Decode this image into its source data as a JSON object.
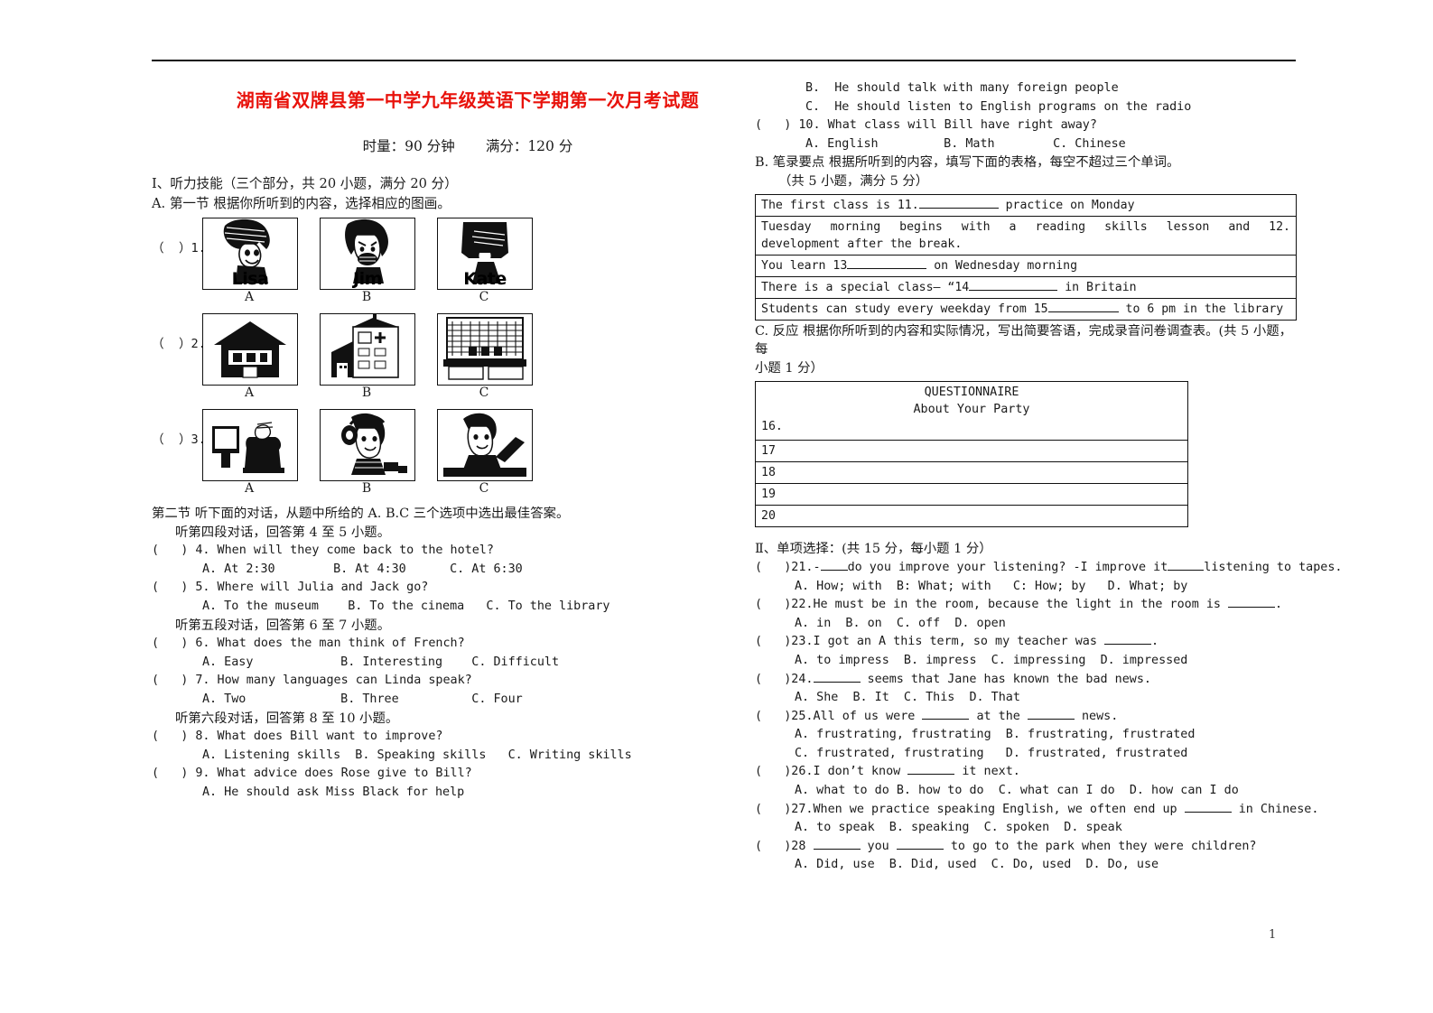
{
  "document": {
    "title": "湖南省双牌县第一中学九年级英语下学期第一次月考试题",
    "time_label": "时量：90 分钟",
    "score_label": "满分：120 分",
    "page_number": "1"
  },
  "left_column": {
    "section_I_heading": "Ⅰ、听力技能（三个部分，共 20 小题，满分 20 分）",
    "part_A_heading": "A.  第一节 根据你所听到的内容，选择相应的图画。",
    "picture_questions": [
      {
        "marker": "（  ）1.",
        "options": [
          {
            "letter": "A",
            "caption": "Lisa",
            "art": "girl-with-hat"
          },
          {
            "letter": "B",
            "caption": "Jim",
            "art": "boy-shouting"
          },
          {
            "letter": "C",
            "caption": "Kate",
            "art": "girl-dark-hair"
          }
        ]
      },
      {
        "marker": "（  ）2.",
        "options": [
          {
            "letter": "A",
            "caption": "",
            "art": "house-building"
          },
          {
            "letter": "B",
            "caption": "",
            "art": "hospital-building"
          },
          {
            "letter": "C",
            "caption": "",
            "art": "library-building"
          }
        ]
      },
      {
        "marker": "（  ）3.",
        "options": [
          {
            "letter": "A",
            "caption": "",
            "art": "watching-tv"
          },
          {
            "letter": "B",
            "caption": "",
            "art": "listening-headphones"
          },
          {
            "letter": "C",
            "caption": "",
            "art": "boy-studying"
          }
        ]
      }
    ],
    "part_B_heading": "第二节 听下面的对话，从题中所给的 A. B.C 三个选项中选出最佳答案。",
    "dialog_4_5_note": "听第四段对话，回答第 4 至 5 小题。",
    "dialog_6_7_note": "听第五段对话，回答第 6 至 7 小题。",
    "dialog_8_10_note": "听第六段对话，回答第 8 至 10 小题。",
    "questions": [
      {
        "marker": "(   ) 4.",
        "stem": " When will they come back to the hotel?",
        "options": "A. At 2:30        B. At 4:30      C. At 6:30"
      },
      {
        "marker": "(   ) 5.",
        "stem": " Where will Julia and Jack go?",
        "options": "A. To the museum    B. To the cinema   C. To the library"
      },
      {
        "marker": "(   ) 6.",
        "stem": " What does the man think of French?",
        "options": "A. Easy            B. Interesting    C. Difficult"
      },
      {
        "marker": "(   ) 7.",
        "stem": " How many languages can Linda speak?",
        "options": "A. Two             B. Three          C. Four"
      },
      {
        "marker": "(   ) 8.",
        "stem": " What does Bill want to improve?",
        "options": "A. Listening skills  B. Speaking skills   C. Writing skills"
      },
      {
        "marker": "(   ) 9.",
        "stem": " What advice does Rose give to Bill?",
        "options": "A. He should ask Miss Black for help"
      }
    ]
  },
  "right_column": {
    "continued_options": [
      "B.  He should talk with many foreign people",
      "C.  He should listen to English programs on the radio"
    ],
    "question_10": {
      "marker": "(   ) 10.",
      "stem": " What class will Bill have right away?",
      "options": "A. English         B. Math        C. Chinese"
    },
    "part_B_notes_heading": "B.  笔录要点  根据所听到的内容，填写下面的表格，每空不超过三个单词。",
    "part_B_notes_sub": "（共 5 小题，满分 5 分）",
    "notes_table": [
      {
        "pre": "The first class is 11.",
        "blank": "b9",
        "post": " practice on Monday",
        "justify": false
      },
      {
        "pre": "Tuesday morning begins with a reading skills lesson and 12.",
        "blank": "",
        "post": "",
        "justify": true,
        "second_line": "development after the break."
      },
      {
        "pre": "You learn 13",
        "blank": "b9",
        "post": " on Wednesday morning",
        "justify": false
      },
      {
        "pre": "There is a special class— “14",
        "blank": "b10",
        "post": " in Britain",
        "justify": false
      },
      {
        "pre": "Students can study every weekday from 15",
        "blank": "b8",
        "post": " to 6 pm in the library",
        "justify": false
      }
    ],
    "part_C_heading": "C.  反应  根据你所听到的内容和实际情况，写出简要答语，完成录音问卷调查表。(共 5 小题，每",
    "part_C_heading2": "小题 1 分）",
    "questionnaire": {
      "title": "QUESTIONNAIRE",
      "subtitle": "About Your Party",
      "rows": [
        "16.",
        "17",
        "18",
        "19",
        "20"
      ]
    },
    "section_II_heading": "Ⅱ、单项选择：(共 15 分，每小题 1 分）",
    "mc_questions": [
      {
        "marker": "(   )21.",
        "stem_parts": [
          "-",
          "u3",
          "do you improve your listening? -I improve it",
          "u4",
          "listening to tapes."
        ],
        "options": "A. How; with  B: What; with   C: How; by   D. What; by"
      },
      {
        "marker": "(   )22.",
        "stem_parts": [
          "He must be in the room, because the light in the room is ",
          "u5",
          "."
        ],
        "options": "A. in  B. on  C. off  D. open"
      },
      {
        "marker": "(   )23.",
        "stem_parts": [
          "I got an A this term, so my teacher was ",
          "u5",
          "."
        ],
        "options": "A. to impress  B. impress  C. impressing  D. impressed"
      },
      {
        "marker": "(   )24.",
        "stem_parts": [
          "",
          "u5",
          " seems that Jane has known the bad news."
        ],
        "options": "A. She  B. It  C. This  D. That"
      },
      {
        "marker": "(   )25.",
        "stem_parts": [
          "All of us were ",
          "u5",
          " at the ",
          "u5",
          " news."
        ],
        "options": "A. frustrating, frustrating  B. frustrating, frustrated",
        "options2": "C. frustrated, frustrating   D. frustrated, frustrated"
      },
      {
        "marker": "(   )26.",
        "stem_parts": [
          "I don’t know ",
          "u5",
          " it next."
        ],
        "options": "A. what to do B. how to do  C. what can I do  D. how can I do"
      },
      {
        "marker": "(   )27.",
        "stem_parts": [
          "When we practice speaking English, we often end up ",
          "u5",
          " in Chinese."
        ],
        "options": "A. to speak  B. speaking  C. spoken  D. speak"
      },
      {
        "marker": "(   )28",
        "stem_parts": [
          " ",
          "u5",
          " you ",
          "u5",
          " to go to the park when they were children?"
        ],
        "options": "A. Did, use  B. Did, used  C. Do, used  D. Do, use"
      }
    ]
  }
}
